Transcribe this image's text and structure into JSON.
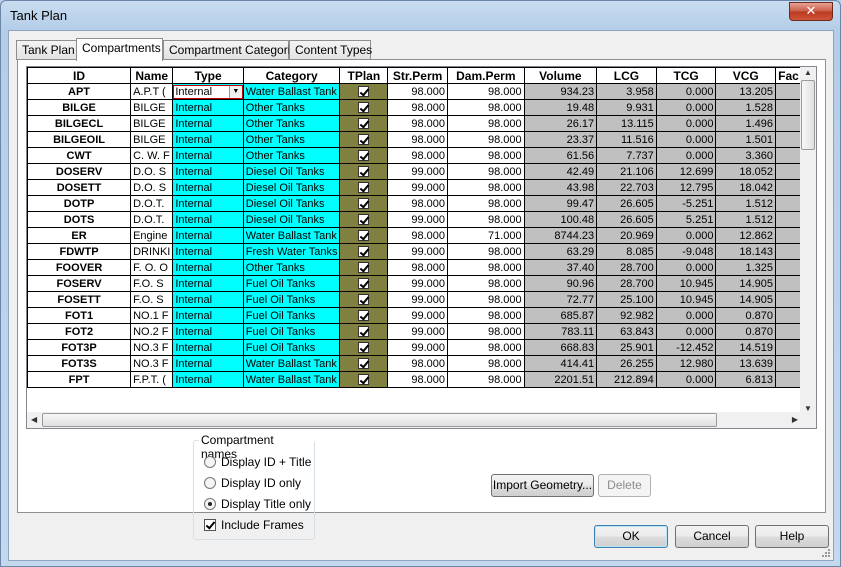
{
  "window": {
    "title": "Tank Plan",
    "close_label": "✕"
  },
  "tabs": [
    {
      "label": "Tank Plan"
    },
    {
      "label": "Compartments"
    },
    {
      "label": "Compartment Categories"
    },
    {
      "label": "Content Types"
    }
  ],
  "grid": {
    "columns": [
      "ID",
      "Name",
      "Type",
      "Category",
      "TPlan",
      "Str.Perm",
      "Dam.Perm",
      "Volume",
      "LCG",
      "TCG",
      "VCG",
      "Fac"
    ],
    "rows": [
      {
        "id": "APT",
        "name": "A.P.T (",
        "type": "Internal",
        "category": "Water Ballast Tank",
        "tplan": true,
        "str_perm": "98.000",
        "dam_perm": "98.000",
        "volume": "934.23",
        "lcg": "3.958",
        "tcg": "0.000",
        "vcg": "13.205"
      },
      {
        "id": "BILGE",
        "name": "BILGE",
        "type": "Internal",
        "category": "Other Tanks",
        "tplan": true,
        "str_perm": "98.000",
        "dam_perm": "98.000",
        "volume": "19.48",
        "lcg": "9.931",
        "tcg": "0.000",
        "vcg": "1.528"
      },
      {
        "id": "BILGECL",
        "name": "BILGE",
        "type": "Internal",
        "category": "Other Tanks",
        "tplan": true,
        "str_perm": "98.000",
        "dam_perm": "98.000",
        "volume": "26.17",
        "lcg": "13.115",
        "tcg": "0.000",
        "vcg": "1.496"
      },
      {
        "id": "BILGEOIL",
        "name": "BILGE",
        "type": "Internal",
        "category": "Other Tanks",
        "tplan": true,
        "str_perm": "98.000",
        "dam_perm": "98.000",
        "volume": "23.37",
        "lcg": "11.516",
        "tcg": "0.000",
        "vcg": "1.501"
      },
      {
        "id": "CWT",
        "name": "C. W. F",
        "type": "Internal",
        "category": "Other Tanks",
        "tplan": true,
        "str_perm": "98.000",
        "dam_perm": "98.000",
        "volume": "61.56",
        "lcg": "7.737",
        "tcg": "0.000",
        "vcg": "3.360"
      },
      {
        "id": "DOSERV",
        "name": "D.O. S",
        "type": "Internal",
        "category": "Diesel Oil Tanks",
        "tplan": true,
        "str_perm": "99.000",
        "dam_perm": "98.000",
        "volume": "42.49",
        "lcg": "21.106",
        "tcg": "12.699",
        "vcg": "18.052"
      },
      {
        "id": "DOSETT",
        "name": "D.O. S",
        "type": "Internal",
        "category": "Diesel Oil Tanks",
        "tplan": true,
        "str_perm": "99.000",
        "dam_perm": "98.000",
        "volume": "43.98",
        "lcg": "22.703",
        "tcg": "12.795",
        "vcg": "18.042"
      },
      {
        "id": "DOTP",
        "name": "D.O.T.",
        "type": "Internal",
        "category": "Diesel Oil Tanks",
        "tplan": true,
        "str_perm": "98.000",
        "dam_perm": "98.000",
        "volume": "99.47",
        "lcg": "26.605",
        "tcg": "-5.251",
        "vcg": "1.512"
      },
      {
        "id": "DOTS",
        "name": "D.O.T.",
        "type": "Internal",
        "category": "Diesel Oil Tanks",
        "tplan": true,
        "str_perm": "99.000",
        "dam_perm": "98.000",
        "volume": "100.48",
        "lcg": "26.605",
        "tcg": "5.251",
        "vcg": "1.512"
      },
      {
        "id": "ER",
        "name": "Engine",
        "type": "Internal",
        "category": "Water Ballast Tank",
        "tplan": true,
        "str_perm": "98.000",
        "dam_perm": "71.000",
        "volume": "8744.23",
        "lcg": "20.969",
        "tcg": "0.000",
        "vcg": "12.862"
      },
      {
        "id": "FDWTP",
        "name": "DRINKI",
        "type": "Internal",
        "category": "Fresh Water Tanks",
        "tplan": true,
        "str_perm": "99.000",
        "dam_perm": "98.000",
        "volume": "63.29",
        "lcg": "8.085",
        "tcg": "-9.048",
        "vcg": "18.143"
      },
      {
        "id": "FOOVER",
        "name": "F. O. O",
        "type": "Internal",
        "category": "Other Tanks",
        "tplan": true,
        "str_perm": "98.000",
        "dam_perm": "98.000",
        "volume": "37.40",
        "lcg": "28.700",
        "tcg": "0.000",
        "vcg": "1.325"
      },
      {
        "id": "FOSERV",
        "name": "F.O. S",
        "type": "Internal",
        "category": "Fuel Oil Tanks",
        "tplan": true,
        "str_perm": "99.000",
        "dam_perm": "98.000",
        "volume": "90.96",
        "lcg": "28.700",
        "tcg": "10.945",
        "vcg": "14.905"
      },
      {
        "id": "FOSETT",
        "name": "F.O. S",
        "type": "Internal",
        "category": "Fuel Oil Tanks",
        "tplan": true,
        "str_perm": "99.000",
        "dam_perm": "98.000",
        "volume": "72.77",
        "lcg": "25.100",
        "tcg": "10.945",
        "vcg": "14.905"
      },
      {
        "id": "FOT1",
        "name": "NO.1 F",
        "type": "Internal",
        "category": "Fuel Oil Tanks",
        "tplan": true,
        "str_perm": "99.000",
        "dam_perm": "98.000",
        "volume": "685.87",
        "lcg": "92.982",
        "tcg": "0.000",
        "vcg": "0.870"
      },
      {
        "id": "FOT2",
        "name": "NO.2 F",
        "type": "Internal",
        "category": "Fuel Oil Tanks",
        "tplan": true,
        "str_perm": "99.000",
        "dam_perm": "98.000",
        "volume": "783.11",
        "lcg": "63.843",
        "tcg": "0.000",
        "vcg": "0.870"
      },
      {
        "id": "FOT3P",
        "name": "NO.3 F",
        "type": "Internal",
        "category": "Fuel Oil Tanks",
        "tplan": true,
        "str_perm": "99.000",
        "dam_perm": "98.000",
        "volume": "668.83",
        "lcg": "25.901",
        "tcg": "-12.452",
        "vcg": "14.519"
      },
      {
        "id": "FOT3S",
        "name": "NO.3 F",
        "type": "Internal",
        "category": "Water Ballast Tank",
        "tplan": true,
        "str_perm": "98.000",
        "dam_perm": "98.000",
        "volume": "414.41",
        "lcg": "26.255",
        "tcg": "12.980",
        "vcg": "13.639"
      },
      {
        "id": "FPT",
        "name": "F.P.T. (",
        "type": "Internal",
        "category": "Water Ballast Tank",
        "tplan": true,
        "str_perm": "98.000",
        "dam_perm": "98.000",
        "volume": "2201.51",
        "lcg": "212.894",
        "tcg": "0.000",
        "vcg": "6.813"
      }
    ]
  },
  "compartment_names": {
    "title": "Compartment names",
    "options": [
      {
        "label": "Display ID + Title",
        "selected": false
      },
      {
        "label": "Display ID only",
        "selected": false
      },
      {
        "label": "Display Title only",
        "selected": true
      }
    ],
    "include_frames": {
      "label": "Include Frames",
      "checked": true
    }
  },
  "buttons": {
    "import_geometry": "Import Geometry...",
    "delete": "Delete",
    "ok": "OK",
    "cancel": "Cancel",
    "help": "Help"
  },
  "colors": {
    "editable": "#00ffff",
    "tplan_column": "#808040",
    "computed": "#c0c0c0"
  }
}
